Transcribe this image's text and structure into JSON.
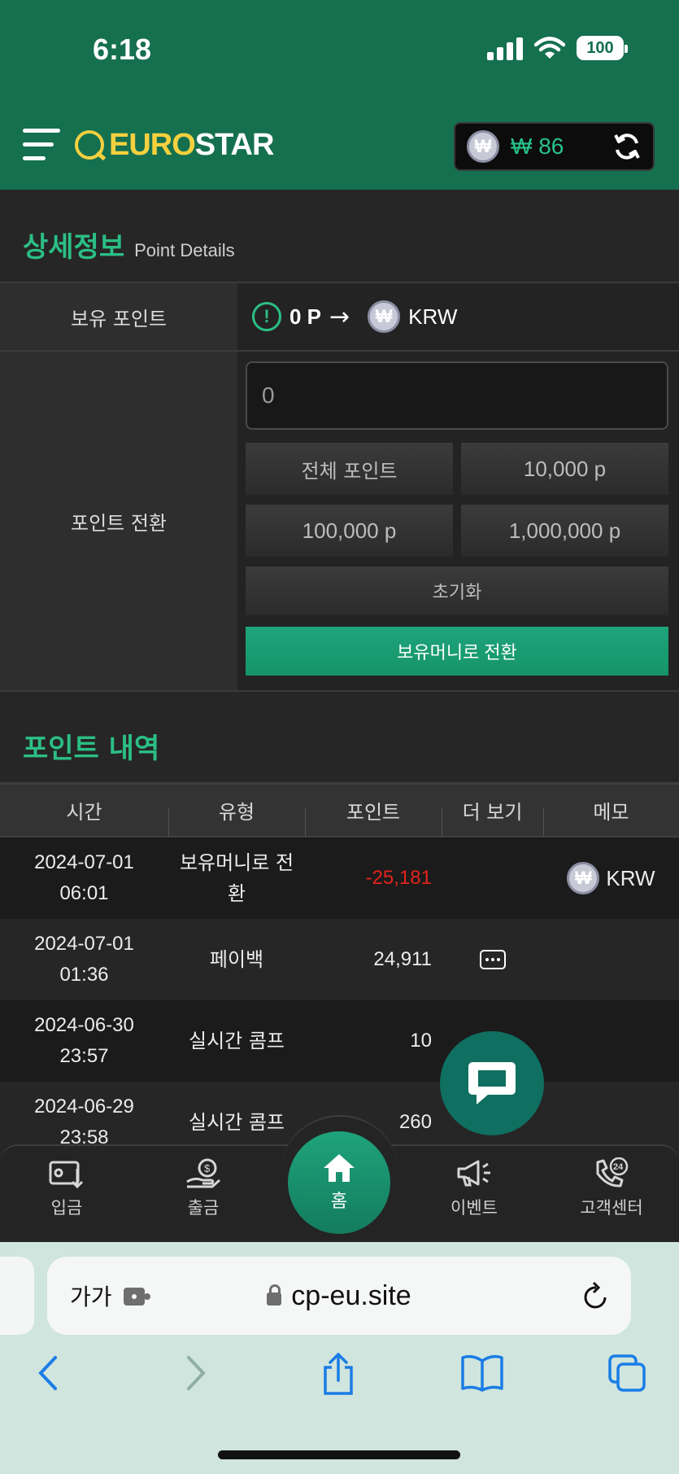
{
  "status": {
    "time": "6:18",
    "battery": "100"
  },
  "header": {
    "logo_euro": "EURO",
    "logo_star": "STAR",
    "wallet_currency_glyph": "₩",
    "wallet_amount": "₩ 86",
    "accent": "#15704f"
  },
  "details": {
    "title_ko": "상세정보",
    "title_en": "Point Details",
    "held_label": "보유 포인트",
    "held_value": "0 P",
    "arrow": "→",
    "target_currency": "KRW",
    "convert_label": "포인트 전환",
    "input_value": "0",
    "btn_all": "전체 포인트",
    "btn_10k": "10,000 p",
    "btn_100k": "100,000 p",
    "btn_1m": "1,000,000 p",
    "btn_reset": "초기화",
    "btn_convert": "보유머니로 전환"
  },
  "history": {
    "title": "포인트 내역",
    "columns": [
      "시간",
      "유형",
      "포인트",
      "더 보기",
      "메모"
    ],
    "rows": [
      {
        "date": "2024-07-01",
        "time": "06:01",
        "type_line1": "보유머니로 전",
        "type_line2": "환",
        "point": "-25,181",
        "memo": "KRW"
      },
      {
        "date": "2024-07-01",
        "time": "01:36",
        "type_line1": "페이백",
        "type_line2": "",
        "point": "24,911",
        "memo": ""
      },
      {
        "date": "2024-06-30",
        "time": "23:57",
        "type_line1": "실시간 콤프",
        "type_line2": "",
        "point": "10",
        "memo": ""
      },
      {
        "date": "2024-06-29",
        "time": "23:58",
        "type_line1": "실시간 콤프",
        "type_line2": "",
        "point": "260",
        "memo": ""
      }
    ]
  },
  "bottom_nav": {
    "deposit": "입금",
    "withdraw": "출금",
    "home": "홈",
    "event": "이벤트",
    "support": "고객센터"
  },
  "browser": {
    "aa": "가가",
    "url": "cp-eu.site"
  }
}
